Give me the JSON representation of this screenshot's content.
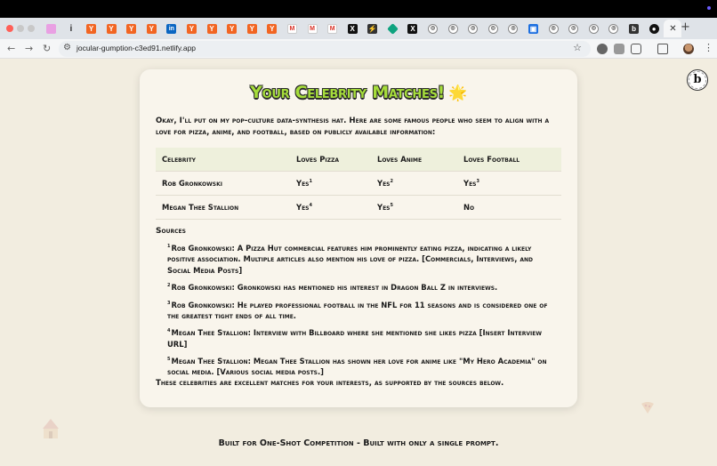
{
  "browser": {
    "tabs": [
      {
        "icon": "pink-tab-icon",
        "glyph": ""
      },
      {
        "icon": "info-tab-icon",
        "glyph": "i"
      },
      {
        "icon": "ycombinator-icon",
        "glyph": "Y"
      },
      {
        "icon": "ycombinator-icon",
        "glyph": "Y"
      },
      {
        "icon": "ycombinator-icon",
        "glyph": "Y"
      },
      {
        "icon": "ycombinator-icon",
        "glyph": "Y"
      },
      {
        "icon": "linkedin-icon",
        "glyph": "in"
      },
      {
        "icon": "ycombinator-icon",
        "glyph": "Y"
      },
      {
        "icon": "ycombinator-icon",
        "glyph": "Y"
      },
      {
        "icon": "ycombinator-icon",
        "glyph": "Y"
      },
      {
        "icon": "ycombinator-icon",
        "glyph": "Y"
      },
      {
        "icon": "ycombinator-icon",
        "glyph": "Y"
      },
      {
        "icon": "gmail-icon",
        "glyph": "M"
      },
      {
        "icon": "gmail-icon",
        "glyph": "M"
      },
      {
        "icon": "gmail-icon",
        "glyph": "M"
      },
      {
        "icon": "x-icon",
        "glyph": "X"
      },
      {
        "icon": "bolt-icon",
        "glyph": "⚡"
      },
      {
        "icon": "diamond-icon",
        "glyph": ""
      },
      {
        "icon": "x-icon",
        "glyph": "X"
      },
      {
        "icon": "globe-icon",
        "glyph": "◎"
      },
      {
        "icon": "globe-icon",
        "glyph": "◎"
      },
      {
        "icon": "globe-icon",
        "glyph": "◎"
      },
      {
        "icon": "globe-icon",
        "glyph": "◎"
      },
      {
        "icon": "globe-icon",
        "glyph": "◎"
      },
      {
        "icon": "dropbox-icon",
        "glyph": "▣"
      },
      {
        "icon": "globe-icon",
        "glyph": "◎"
      },
      {
        "icon": "globe-icon",
        "glyph": "◎"
      },
      {
        "icon": "globe-icon",
        "glyph": "◎"
      },
      {
        "icon": "globe-icon",
        "glyph": "◎"
      },
      {
        "icon": "b-logo-icon",
        "glyph": "b"
      },
      {
        "icon": "github-icon",
        "glyph": "●"
      }
    ],
    "active_tab_close": "✕",
    "new_tab": "+",
    "url": "jocular-gumption-c3ed91.netlify.app"
  },
  "page": {
    "title": "Your Celebrity Matches!",
    "title_emoji": "🌟",
    "intro": "Okay, I'll put on my pop-culture data-synthesis hat. Here are some famous people who seem to align with a love for pizza, anime, and football, based on publicly available information:",
    "table": {
      "headers": [
        "Celebrity",
        "Loves Pizza",
        "Loves Anime",
        "Loves Football"
      ],
      "rows": [
        {
          "name": "Rob Gronkowski",
          "pizza": "Yes",
          "pizza_ref": "1",
          "anime": "Yes",
          "anime_ref": "2",
          "football": "Yes",
          "football_ref": "3"
        },
        {
          "name": "Megan Thee Stallion",
          "pizza": "Yes",
          "pizza_ref": "4",
          "anime": "Yes",
          "anime_ref": "5",
          "football": "No",
          "football_ref": ""
        }
      ]
    },
    "sources_heading": "Sources",
    "sources": [
      {
        "ref": "1",
        "text": "Rob Gronkowski: A Pizza Hut commercial features him prominently eating pizza, indicating a likely positive association. Multiple articles also mention his love of pizza. [Commercials, Interviews, and Social Media Posts]"
      },
      {
        "ref": "2",
        "text": "Rob Gronkowski: Gronkowski has mentioned his interest in Dragon Ball Z in interviews."
      },
      {
        "ref": "3",
        "text": "Rob Gronkowski: He played professional football in the NFL for 11 seasons and is considered one of the greatest tight ends of all time."
      },
      {
        "ref": "4",
        "text": "Megan Thee Stallion: Interview with Billboard where she mentioned she likes pizza [Insert Interview URL]"
      },
      {
        "ref": "5",
        "text": "Megan Thee Stallion: Megan Thee Stallion has shown her love for anime like \"My Hero Academia\" on social media. [Various social media posts.]"
      }
    ],
    "closing": "These celebrities are excellent matches for your interests, as supported by the sources below.",
    "footer": "Built for One-Shot Competition - Built with only a single prompt."
  },
  "colors": {
    "title_fill": "#a6dd3b",
    "page_bg": "#f2ede0",
    "card_bg": "#f9f5ec",
    "table_header_bg": "#eef0dc"
  }
}
